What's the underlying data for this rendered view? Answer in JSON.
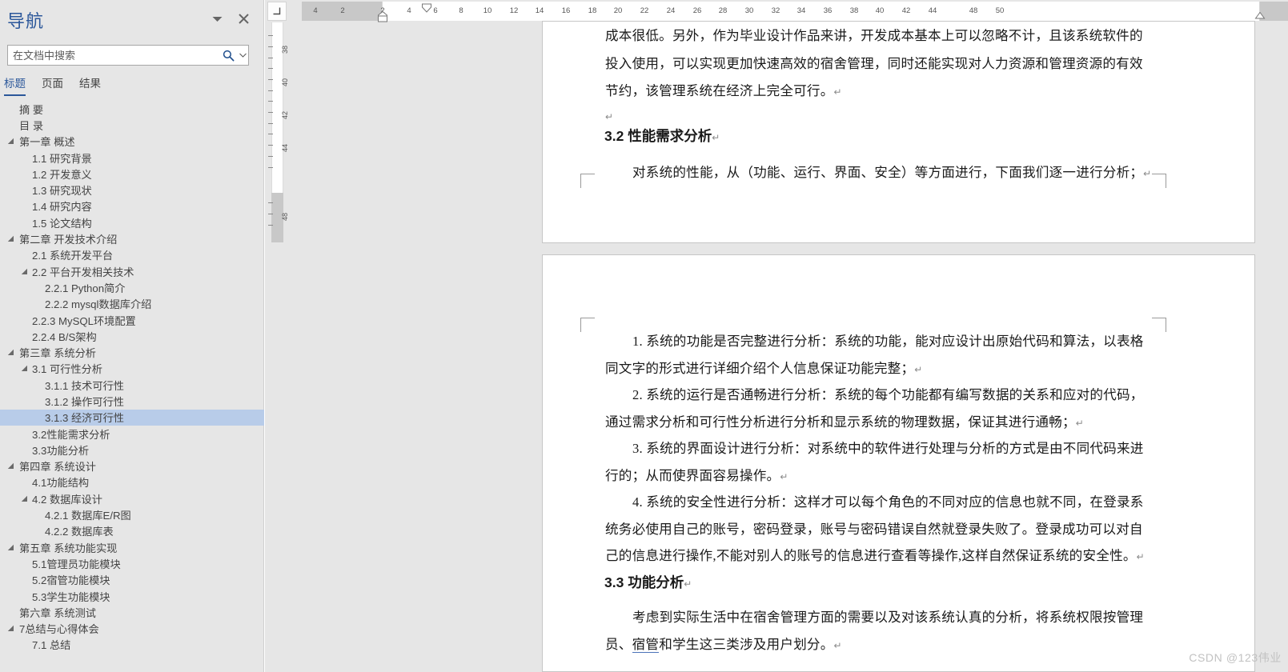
{
  "navigation": {
    "title": "导航",
    "collapse_icon": "chevron-down-icon",
    "close_icon": "close-icon",
    "search": {
      "placeholder": "在文档中搜索",
      "value": "",
      "icon": "search-icon",
      "dropdown_icon": "chevron-down-icon"
    },
    "tabs": [
      {
        "label": "标题",
        "active": true
      },
      {
        "label": "页面",
        "active": false
      },
      {
        "label": "结果",
        "active": false
      }
    ],
    "selected_heading": "3.1.3 经济可行性",
    "headings": [
      {
        "label": "摘 要",
        "level": 0,
        "expander": "none",
        "selected": false
      },
      {
        "label": "目 录",
        "level": 0,
        "expander": "none",
        "selected": false
      },
      {
        "label": "第一章 概述",
        "level": 0,
        "expander": "expanded",
        "selected": false
      },
      {
        "label": "1.1 研究背景",
        "level": 1,
        "expander": "none",
        "selected": false
      },
      {
        "label": "1.2 开发意义",
        "level": 1,
        "expander": "none",
        "selected": false
      },
      {
        "label": "1.3 研究现状",
        "level": 1,
        "expander": "none",
        "selected": false
      },
      {
        "label": "1.4 研究内容",
        "level": 1,
        "expander": "none",
        "selected": false
      },
      {
        "label": "1.5 论文结构",
        "level": 1,
        "expander": "none",
        "selected": false
      },
      {
        "label": "第二章 开发技术介绍",
        "level": 0,
        "expander": "expanded",
        "selected": false
      },
      {
        "label": "2.1 系统开发平台",
        "level": 1,
        "expander": "none",
        "selected": false
      },
      {
        "label": "2.2 平台开发相关技术",
        "level": 1,
        "expander": "expanded",
        "selected": false
      },
      {
        "label": "2.2.1  Python简介",
        "level": 2,
        "expander": "none",
        "selected": false
      },
      {
        "label": "2.2.2  mysql数据库介绍",
        "level": 2,
        "expander": "none",
        "selected": false
      },
      {
        "label": "2.2.3  MySQL环境配置",
        "level": 1,
        "expander": "none",
        "selected": false
      },
      {
        "label": "2.2.4  B/S架构",
        "level": 1,
        "expander": "none",
        "selected": false
      },
      {
        "label": "第三章 系统分析",
        "level": 0,
        "expander": "expanded",
        "selected": false
      },
      {
        "label": "3.1 可行性分析",
        "level": 1,
        "expander": "expanded",
        "selected": false
      },
      {
        "label": "3.1.1 技术可行性",
        "level": 2,
        "expander": "none",
        "selected": false
      },
      {
        "label": "3.1.2 操作可行性",
        "level": 2,
        "expander": "none",
        "selected": false
      },
      {
        "label": "3.1.3 经济可行性",
        "level": 2,
        "expander": "none",
        "selected": true
      },
      {
        "label": "3.2性能需求分析",
        "level": 1,
        "expander": "none",
        "selected": false
      },
      {
        "label": "3.3功能分析",
        "level": 1,
        "expander": "none",
        "selected": false
      },
      {
        "label": "第四章 系统设计",
        "level": 0,
        "expander": "expanded",
        "selected": false
      },
      {
        "label": "4.1功能结构",
        "level": 1,
        "expander": "none",
        "selected": false
      },
      {
        "label": "4.2 数据库设计",
        "level": 1,
        "expander": "expanded",
        "selected": false
      },
      {
        "label": "4.2.1 数据库E/R图",
        "level": 2,
        "expander": "none",
        "selected": false
      },
      {
        "label": "4.2.2 数据库表",
        "level": 2,
        "expander": "none",
        "selected": false
      },
      {
        "label": "第五章 系统功能实现",
        "level": 0,
        "expander": "expanded",
        "selected": false
      },
      {
        "label": "5.1管理员功能模块",
        "level": 1,
        "expander": "none",
        "selected": false
      },
      {
        "label": "5.2宿管功能模块",
        "level": 1,
        "expander": "none",
        "selected": false
      },
      {
        "label": "5.3学生功能模块",
        "level": 1,
        "expander": "none",
        "selected": false
      },
      {
        "label": "第六章 系统测试",
        "level": 0,
        "expander": "none",
        "selected": false
      },
      {
        "label": "7总结与心得体会",
        "level": 0,
        "expander": "expanded",
        "selected": false
      },
      {
        "label": "7.1 总结",
        "level": 1,
        "expander": "none",
        "selected": false
      }
    ]
  },
  "rulers": {
    "corner_icon": "tab-stop-icon",
    "horizontal_ticks": [
      "4",
      "2",
      "2",
      "4",
      "6",
      "8",
      "10",
      "12",
      "14",
      "16",
      "18",
      "20",
      "22",
      "24",
      "26",
      "28",
      "30",
      "32",
      "34",
      "36",
      "38",
      "40",
      "42",
      "44",
      "48",
      "50"
    ],
    "vertical_ticks": [
      "38",
      "40",
      "42",
      "44",
      "48"
    ],
    "first_line_indent": "2",
    "left_indent_marker": "hanging-indent-marker",
    "right_indent_marker": "right-indent-marker"
  },
  "document": {
    "page1": {
      "lines": [
        {
          "text": "成本很低。另外，作为毕业设计作品来讲，开发成本基本上可以忽略不计，且该系统软件的",
          "type": "body",
          "pilcrow": false
        },
        {
          "text": "投入使用，可以实现更加快速高效的宿舍管理，同时还能实现对人力资源和管理资源的有效",
          "type": "body",
          "pilcrow": false
        },
        {
          "text": "节约，该管理系统在经济上完全可行。",
          "type": "body",
          "pilcrow": true
        },
        {
          "text": "",
          "type": "body",
          "pilcrow": true
        },
        {
          "text": "3.2 性能需求分析",
          "type": "heading",
          "pilcrow": true
        },
        {
          "text": "对系统的性能，从（功能、运行、界面、安全）等方面进行，下面我们逐一进行分析；",
          "type": "body-indent",
          "pilcrow": true
        }
      ]
    },
    "page2": {
      "lines": [
        {
          "text": "1.  系统的功能是否完整进行分析：系统的功能，能对应设计出原始代码和算法，以表格",
          "type": "body-indent",
          "pilcrow": false
        },
        {
          "text": "同文字的形式进行详细介绍个人信息保证功能完整；",
          "type": "body",
          "pilcrow": true
        },
        {
          "text": "2.  系统的运行是否通畅进行分析：系统的每个功能都有编写数据的关系和应对的代码，",
          "type": "body-indent",
          "pilcrow": false
        },
        {
          "text": "通过需求分析和可行性分析进行分析和显示系统的物理数据，保证其进行通畅；",
          "type": "body",
          "pilcrow": true
        },
        {
          "text": "3.  系统的界面设计进行分析：对系统中的软件进行处理与分析的方式是由不同代码来进",
          "type": "body-indent",
          "pilcrow": false
        },
        {
          "text": "行的；从而使界面容易操作。",
          "type": "body",
          "pilcrow": true
        },
        {
          "text": "4.  系统的安全性进行分析：这样才可以每个角色的不同对应的信息也就不同，在登录系",
          "type": "body-indent",
          "pilcrow": false
        },
        {
          "text": "统务必使用自己的账号，密码登录，账号与密码错误自然就登录失败了。登录成功可以对自",
          "type": "body",
          "pilcrow": false
        },
        {
          "text": "己的信息进行操作,不能对别人的账号的信息进行查看等操作,这样自然保证系统的安全性。",
          "type": "body",
          "pilcrow": true
        },
        {
          "text": "3.3 功能分析",
          "type": "heading",
          "pilcrow": true
        },
        {
          "text": "考虑到实际生活中在宿舍管理方面的需要以及对该系统认真的分析，将系统权限按管理",
          "type": "body-indent",
          "pilcrow": false
        }
      ],
      "last_line_parts": [
        {
          "text": "员、",
          "underline": false
        },
        {
          "text": "宿管",
          "underline": true
        },
        {
          "text": "和学生这三类涉及用户划分。",
          "underline": false
        }
      ]
    }
  },
  "watermark": "CSDN @123伟业",
  "colors": {
    "accent": "#2b579a",
    "selection": "#b8cce9",
    "pane_bg": "#e6e6e6",
    "page_bg": "#ffffff"
  }
}
